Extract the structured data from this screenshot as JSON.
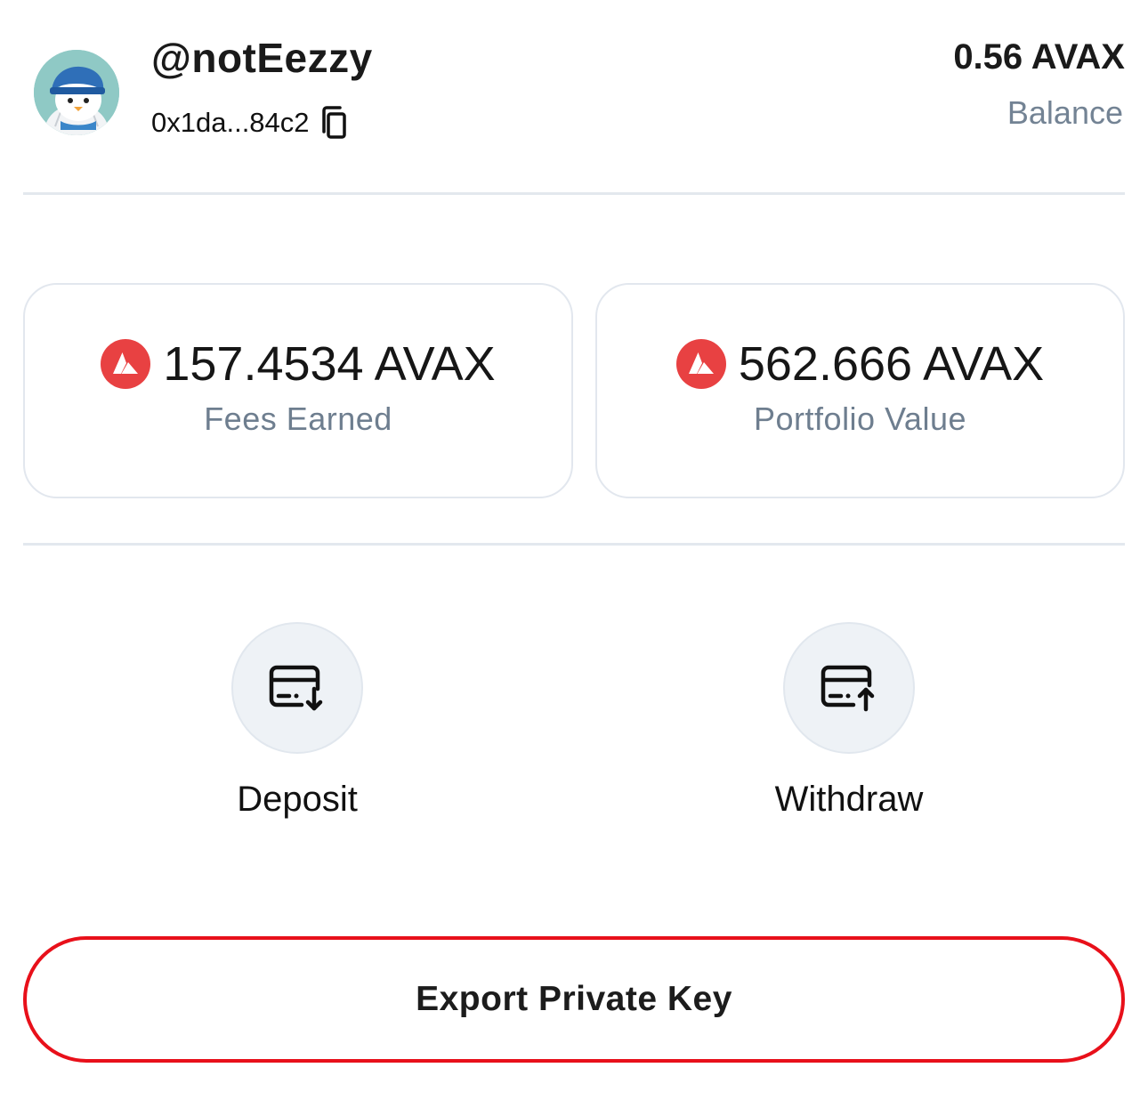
{
  "profile": {
    "username": "@notEezzy",
    "address": "0x1da...84c2",
    "avatar_icon": "penguin-avatar"
  },
  "balance": {
    "value": "0.56 AVAX",
    "label": "Balance"
  },
  "stats": [
    {
      "value": "157.4534 AVAX",
      "label": "Fees Earned",
      "icon": "avax-logo"
    },
    {
      "value": "562.666 AVAX",
      "label": "Portfolio Value",
      "icon": "avax-logo"
    }
  ],
  "actions": [
    {
      "label": "Deposit",
      "icon": "card-download-icon"
    },
    {
      "label": "Withdraw",
      "icon": "card-upload-icon"
    }
  ],
  "export_button": {
    "label": "Export Private Key"
  },
  "colors": {
    "avax_red": "#e84142",
    "export_border": "#e8101a",
    "muted_text": "#738394",
    "card_border": "#e2e7ee",
    "action_bg": "#eef2f6"
  }
}
